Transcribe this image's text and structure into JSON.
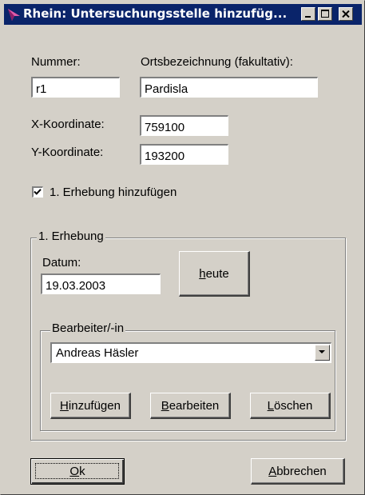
{
  "window": {
    "title": "Rhein: Untersuchungsstelle hinzufüg...",
    "title_color": "#0a246a",
    "face_color": "#d4d0c8"
  },
  "titlebar_buttons": [
    "minimize-icon",
    "maximize-icon",
    "close-icon"
  ],
  "form": {
    "nummer_label": "Nummer:",
    "nummer_value": "r1",
    "ort_label": "Ortsbezeichnung (fakultativ):",
    "ort_value": "Pardisla",
    "x_label": "X-Koordinate:",
    "x_value": "759100",
    "y_label": "Y-Koordinate:",
    "y_value": "193200",
    "checkbox_label": "1. Erhebung hinzufügen",
    "checkbox_checked": true
  },
  "erhebung": {
    "group_title": "1. Erhebung",
    "datum_label": "Datum:",
    "datum_value": "19.03.2003",
    "heute_button": {
      "mnemonic": "h",
      "rest": "eute"
    },
    "bearbeiter": {
      "group_title": "Bearbeiter/-in",
      "selected": "Andreas Häsler",
      "buttons": [
        {
          "mnemonic": "H",
          "rest": "inzufügen"
        },
        {
          "mnemonic": "B",
          "rest": "earbeiten"
        },
        {
          "mnemonic": "L",
          "rest": "öschen"
        }
      ]
    }
  },
  "footer": {
    "ok_button": {
      "mnemonic": "O",
      "rest": "k"
    },
    "cancel_button": {
      "mnemonic": "A",
      "rest": "bbrechen"
    }
  }
}
